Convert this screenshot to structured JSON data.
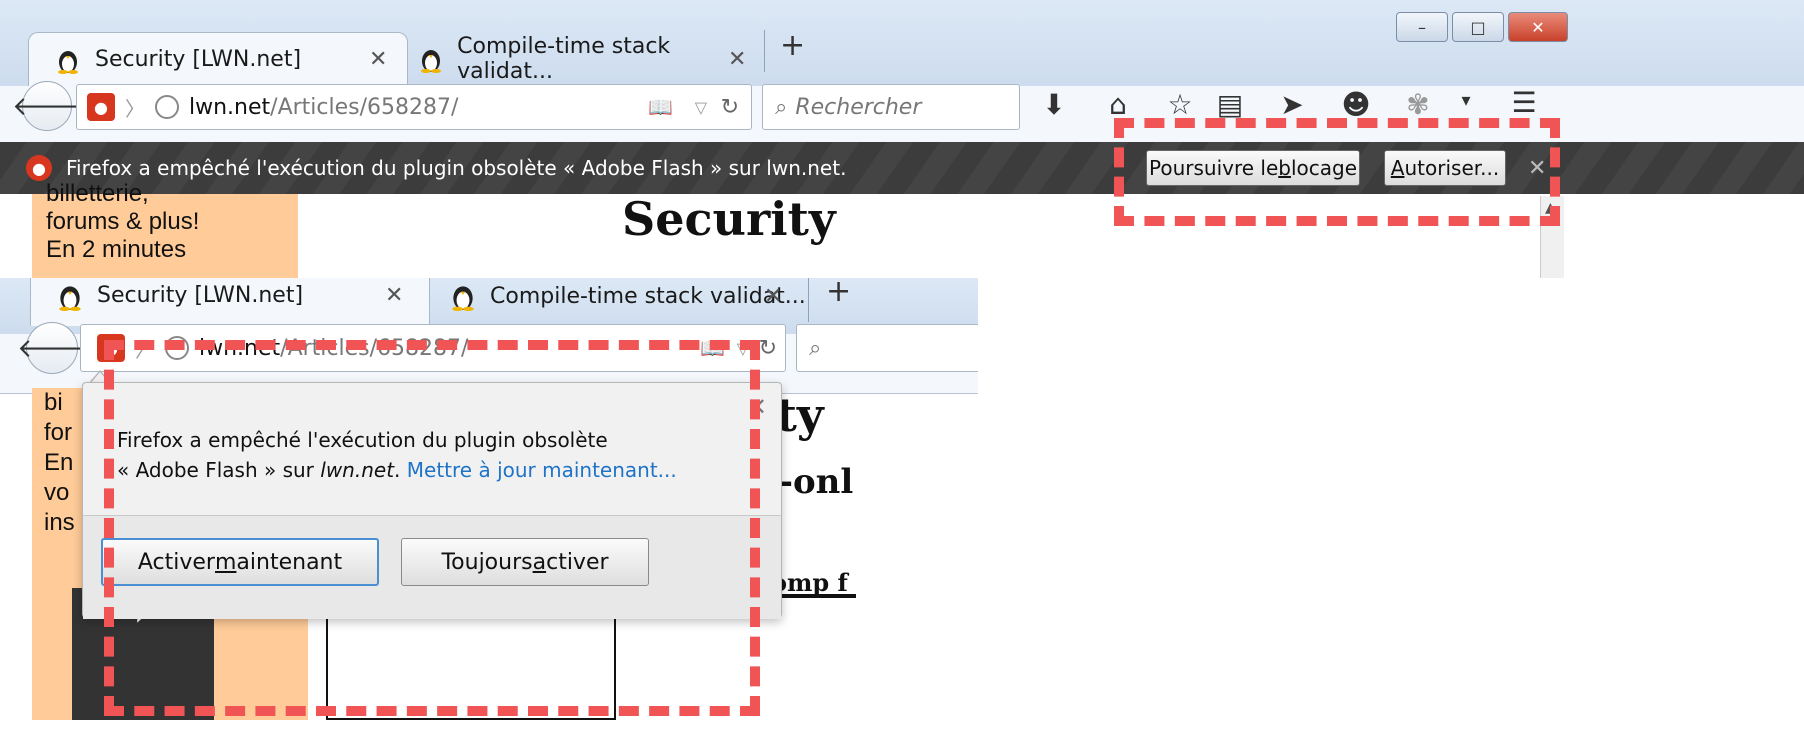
{
  "top": {
    "tabs": [
      {
        "label": "Security [LWN.net]",
        "close": "✕"
      },
      {
        "label": "Compile-time stack validat...",
        "close": "✕"
      }
    ],
    "new_tab": "+",
    "window_controls": {
      "minimize": "–",
      "maximize": "□",
      "close": "✕"
    },
    "url": {
      "host": "lwn.net",
      "path": "/Articles/658287/"
    },
    "search_placeholder": "Rechercher",
    "notification": {
      "message": "Firefox a empêché l'exécution du plugin obsolète « Adobe Flash » sur lwn.net.",
      "continue_before": "Poursuivre le ",
      "continue_underline": "b",
      "continue_after": "locage",
      "allow_underline": "A",
      "allow_after": "utoriser...",
      "close": "✕"
    },
    "sidebar_text": [
      "billetterie,",
      "forums & plus!",
      "En 2 minutes"
    ],
    "page_title": "Security"
  },
  "bottom": {
    "tabs": [
      {
        "label": "Security [LWN.net]",
        "close": "✕"
      },
      {
        "label": "Compile-time stack validat...",
        "close": "✕"
      }
    ],
    "new_tab": "+",
    "url": {
      "host": "lwn.net",
      "path": "/Articles/658287/"
    },
    "sidebar_text": [
      "bi",
      "for",
      "En",
      "vo",
      "ins"
    ],
    "page_title": "Security",
    "page_subtitle": "criber-onl",
    "page_heading3": "or seccomp f",
    "popup": {
      "line1": "Firefox a empêché l'exécution du plugin obsolète",
      "line2_before": "« Adobe Flash » sur ",
      "line2_host": "lwn.net",
      "line2_after": ". ",
      "update_link": "Mettre à jour maintenant...",
      "activate_before": "Activer ",
      "activate_underline": "m",
      "activate_after": "aintenant",
      "always_before": "Toujours ",
      "always_underline": "a",
      "always_after": "ctiver",
      "close": "✕"
    },
    "next_arrow": "›"
  },
  "colors": {
    "annotation": "#f05454",
    "plugin_icon": "#d8371f",
    "link": "#1f74c8",
    "sidebar": "#ffcc99"
  }
}
